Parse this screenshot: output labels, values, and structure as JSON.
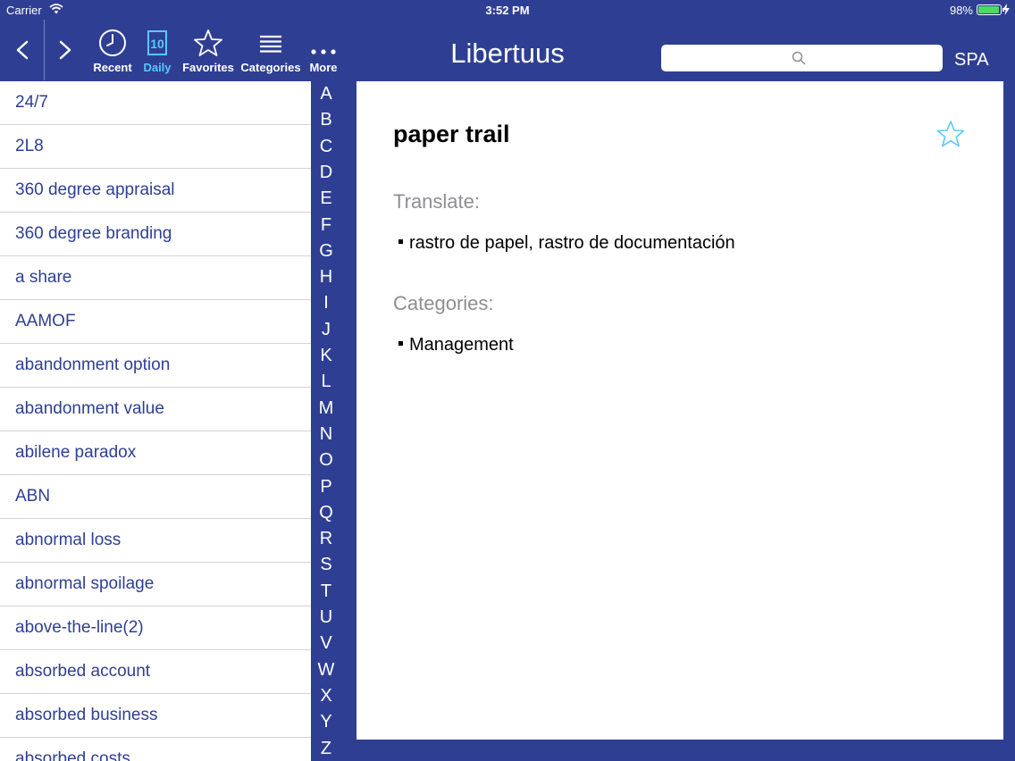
{
  "status_bar": {
    "carrier": "Carrier",
    "time": "3:52 PM",
    "battery": "98%",
    "battery_level": 0.98
  },
  "toolbar": {
    "recent_label": "Recent",
    "daily_label": "Daily",
    "daily_number": "10",
    "favorites_label": "Favorites",
    "categories_label": "Categories",
    "more_label": "More",
    "title": "Libertuus",
    "search_value": "",
    "language": "SPA"
  },
  "colors": {
    "brand": "#2e3f93",
    "accent": "#5ac8fa",
    "list_text": "#2e3f93"
  },
  "term_list": [
    "24/7",
    "2L8",
    "360 degree appraisal",
    "360 degree branding",
    "a share",
    "AAMOF",
    "abandonment option",
    "abandonment value",
    "abilene paradox",
    "ABN",
    "abnormal loss",
    "abnormal spoilage",
    "above-the-line(2)",
    "absorbed account",
    "absorbed business",
    "absorbed costs"
  ],
  "alphabet": [
    "A",
    "B",
    "C",
    "D",
    "E",
    "F",
    "G",
    "H",
    "I",
    "J",
    "K",
    "L",
    "M",
    "N",
    "O",
    "P",
    "Q",
    "R",
    "S",
    "T",
    "U",
    "V",
    "W",
    "X",
    "Y",
    "Z"
  ],
  "detail": {
    "word": "paper trail",
    "translate_label": "Translate:",
    "translation": "rastro de papel, rastro de documentación",
    "categories_label": "Categories:",
    "category": "Management"
  }
}
